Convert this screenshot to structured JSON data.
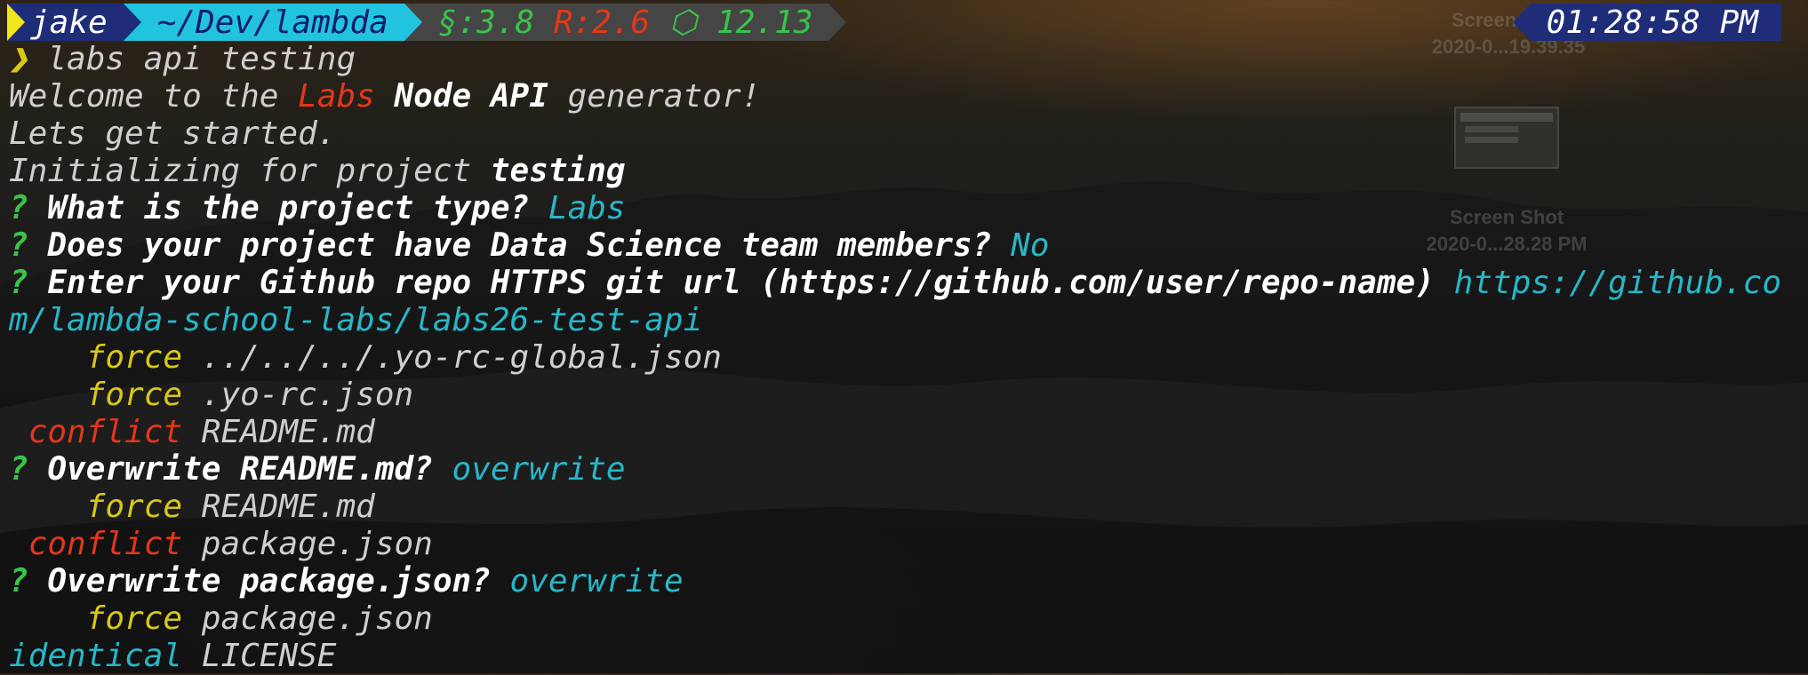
{
  "prompt": {
    "user": "jake",
    "path": "~/Dev/lambda",
    "ruby_label": "§:3.8",
    "r_label": "R:2.6",
    "node_symbol": "⬡",
    "node_version": "12.13"
  },
  "clock": "01:28:58 PM",
  "desktop": {
    "icon1_title": "Screen Shot",
    "icon1_sub": "2020-0...19.39.35",
    "icon2_title": "Screen Shot",
    "icon2_sub": "2020-0...28.28 PM"
  },
  "lines": {
    "cmd_marker": "❯",
    "cmd": " labs api testing",
    "welcome_pre": "Welcome to the ",
    "welcome_labs": "Labs",
    "welcome_node": " Node API",
    "welcome_post": " generator!",
    "started": "Lets get started.",
    "init_pre": "Initializing for project ",
    "init_name": "testing",
    "q_mark": "?",
    "q1": " What is the project type? ",
    "a1": "Labs",
    "q2": " Does your project have Data Science team members? ",
    "a2": "No",
    "q3": " Enter your Github repo HTTPS git url (https://github.com/user/repo-name) ",
    "a3_part1": "https://github.co",
    "a3_part2": "m/lambda-school-labs/labs26-test-api",
    "force_label": "force",
    "file_global": "../../../.yo-rc-global.json",
    "file_yorc": ".yo-rc.json",
    "conflict_label": "conflict",
    "file_readme": "README.md",
    "q4": " Overwrite README.md? ",
    "a4": "overwrite",
    "file_package": "package.json",
    "q5": " Overwrite package.json? ",
    "a5": "overwrite",
    "identical_label": "identical",
    "file_license": "LICENSE"
  },
  "colors": {
    "user_bg": "#1f2d78",
    "path_bg": "#22c3de",
    "env_bg": "#454545",
    "question": "#39c34a",
    "error": "#e2371b",
    "force": "#d8c815",
    "answer": "#27b7c8"
  }
}
